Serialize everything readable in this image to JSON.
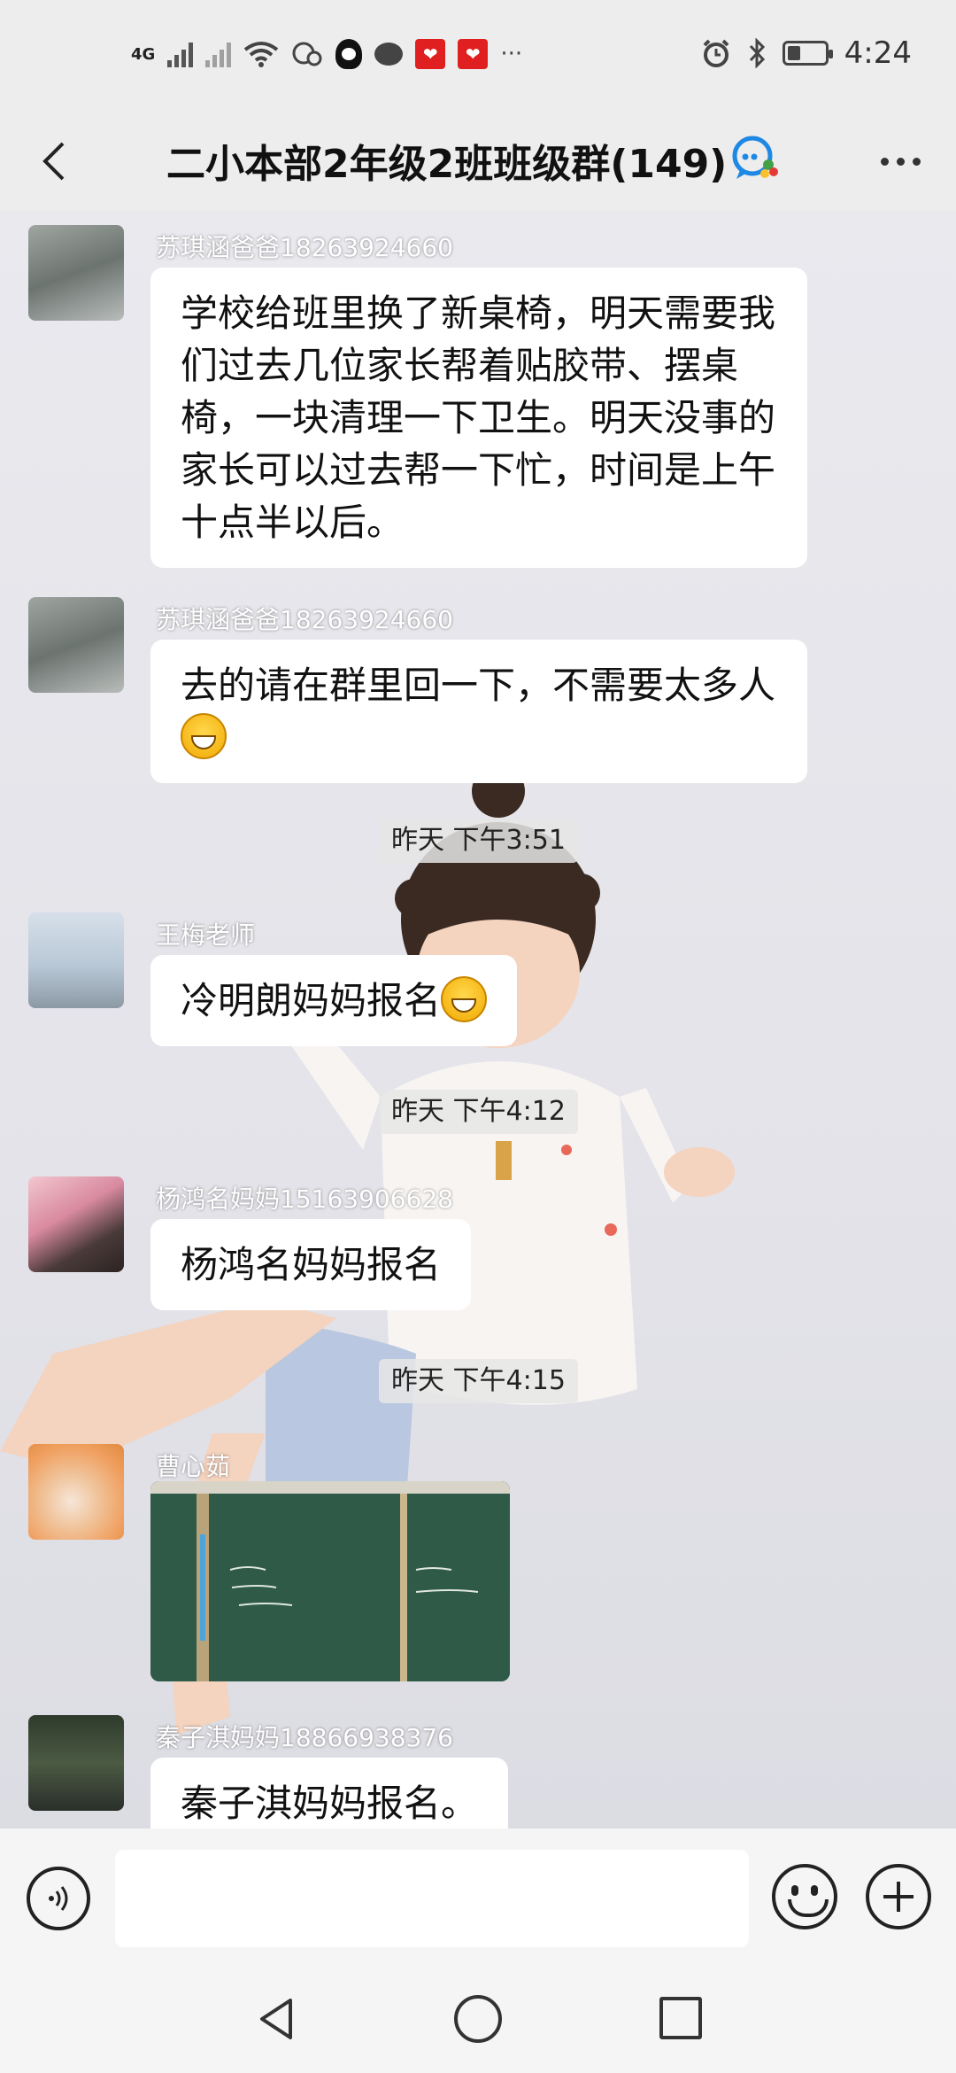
{
  "status_bar": {
    "network": "4G",
    "time": "4:24"
  },
  "header": {
    "title": "二小本部2年级2班班级群(149)"
  },
  "messages": [
    {
      "sender": "苏琪涵爸爸18263924660",
      "text": "学校给班里换了新桌椅，明天需要我们过去几位家长帮着贴胶带、摆桌椅，一块清理一下卫生。明天没事的家长可以过去帮一下忙，时间是上午十点半以后。"
    },
    {
      "sender": "苏琪涵爸爸18263924660",
      "text": "去的请在群里回一下，不需要太多人"
    },
    {
      "timestamp": "昨天 下午3:51"
    },
    {
      "sender": "王梅老师",
      "text": "冷明朗妈妈报名"
    },
    {
      "timestamp": "昨天 下午4:12"
    },
    {
      "sender": "杨鸿名妈妈15163906628",
      "text": "杨鸿名妈妈报名"
    },
    {
      "timestamp": "昨天 下午4:15"
    },
    {
      "sender": "曹心茹",
      "photo": "blackboard-photo"
    },
    {
      "sender": "秦子淇妈妈18866938376",
      "text": "秦子淇妈妈报名。"
    }
  ],
  "colors": {
    "header_bg": "#ededed",
    "bubble_bg": "#ffffff",
    "accent": "#1e88e5"
  },
  "icons": {
    "back": "back-arrow-icon",
    "more": "more-dots-icon",
    "voice": "voice-icon",
    "emoji": "emoji-icon",
    "plus": "plus-icon"
  }
}
